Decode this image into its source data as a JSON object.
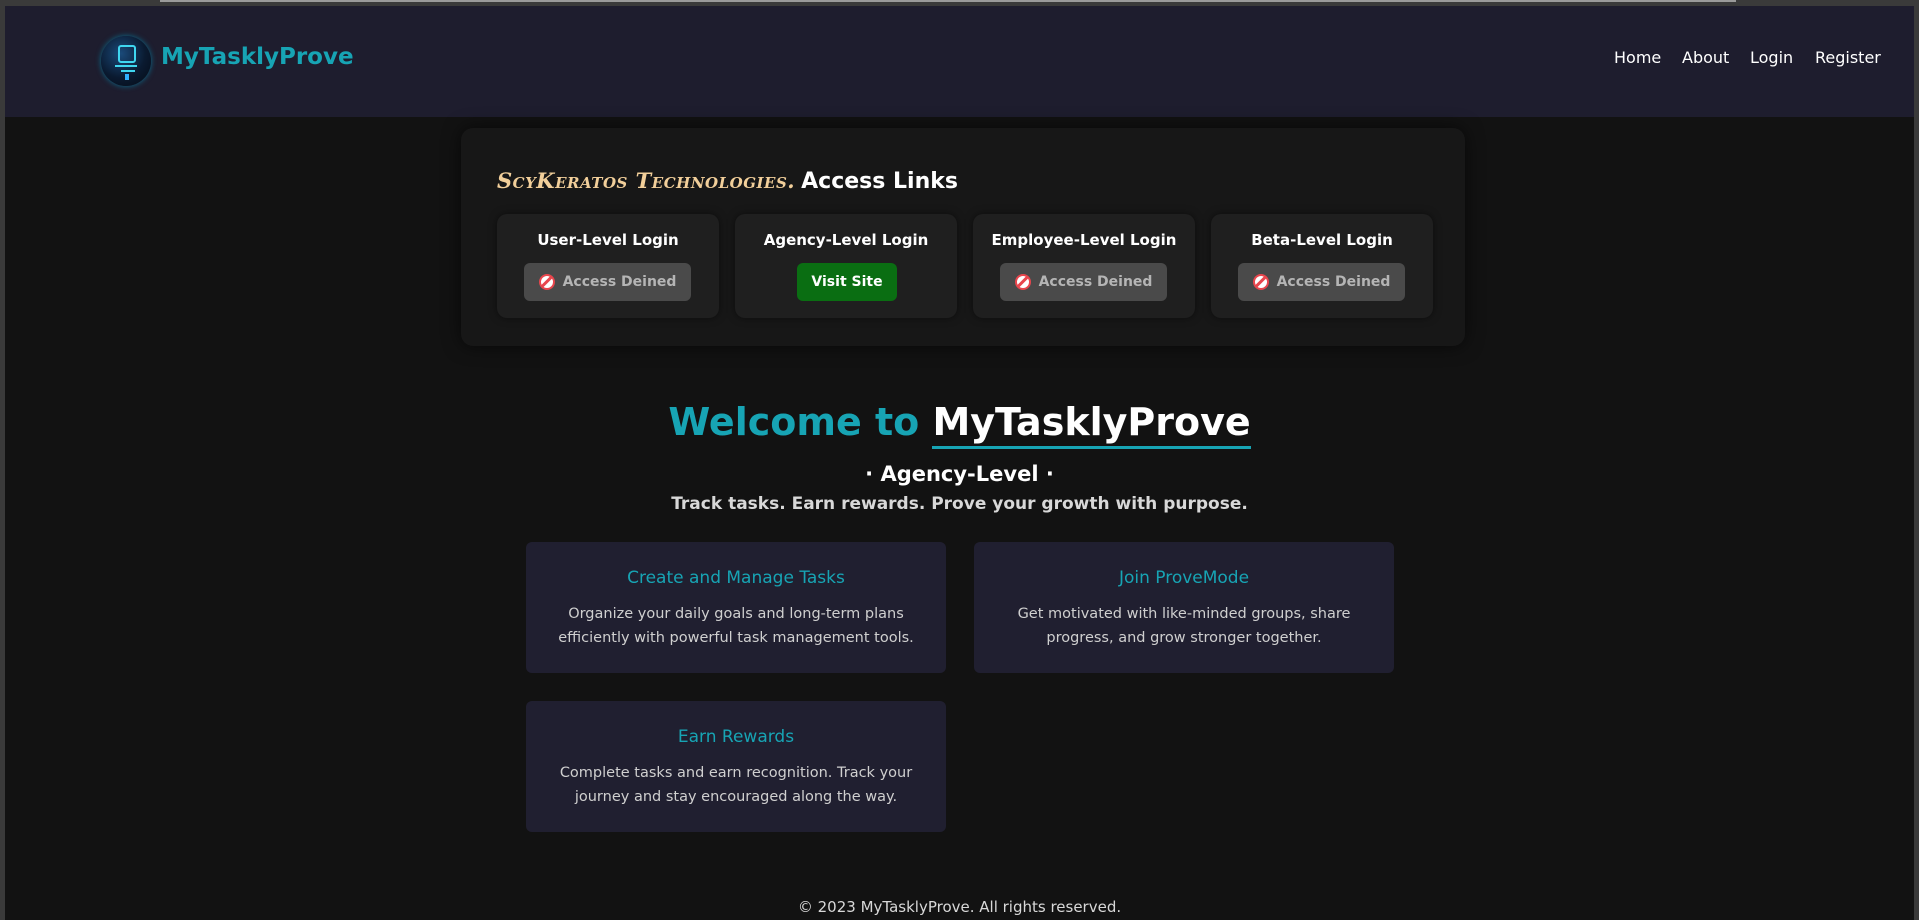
{
  "header": {
    "brand": "MyTasklyProve",
    "nav": [
      "Home",
      "About",
      "Login",
      "Register"
    ]
  },
  "access": {
    "company": "ScyKeratos Technologies.",
    "title": "Access Links",
    "cards": [
      {
        "title": "User-Level Login",
        "button": "Access Deined",
        "state": "denied"
      },
      {
        "title": "Agency-Level Login",
        "button": "Visit Site",
        "state": "active"
      },
      {
        "title": "Employee-Level Login",
        "button": "Access Deined",
        "state": "denied"
      },
      {
        "title": "Beta-Level Login",
        "button": "Access Deined",
        "state": "denied"
      }
    ]
  },
  "hero": {
    "welcome": "Welcome to",
    "app_name": "MyTasklyProve",
    "level": "· Agency-Level ·",
    "tagline": "Track tasks. Earn rewards. Prove your growth with purpose."
  },
  "features": [
    {
      "title": "Create and Manage Tasks",
      "text": "Organize your daily goals and long-term plans efficiently with powerful task management tools."
    },
    {
      "title": "Join ProveMode",
      "text": "Get motivated with like-minded groups, share progress, and grow stronger together."
    },
    {
      "title": "Earn Rewards",
      "text": "Complete tasks and earn recognition. Track your journey and stay encouraged along the way."
    }
  ],
  "footer": "© 2023 MyTasklyProve. All rights reserved.",
  "colors": {
    "accent": "#17a4b4",
    "header_bg": "#1e1d2e",
    "page_bg": "#121212",
    "visit_button": "#0a6e12",
    "denied_button": "#4a4a4a"
  },
  "icons": {
    "denied": "no-entry-icon",
    "logo": "logo-icon"
  }
}
